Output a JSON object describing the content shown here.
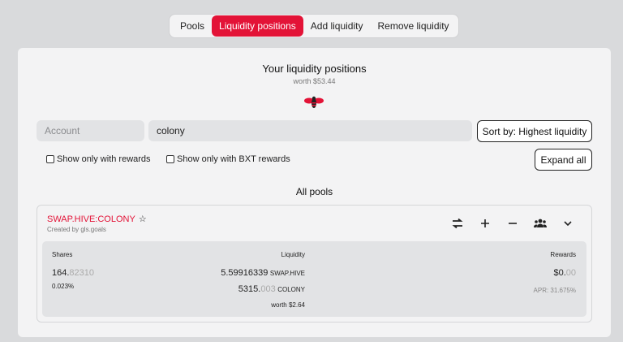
{
  "nav": {
    "tabs": [
      {
        "label": "Pools",
        "active": false
      },
      {
        "label": "Liquidity positions",
        "active": true
      },
      {
        "label": "Add liquidity",
        "active": false
      },
      {
        "label": "Remove liquidity",
        "active": false
      }
    ]
  },
  "header": {
    "title": "Your liquidity positions",
    "worth": "worth $53.44",
    "logo_icon": "hive-bee-icon"
  },
  "filters": {
    "account_placeholder": "Account",
    "search_value": "colony",
    "sort_label": "Sort by: Highest liquidity",
    "checkbox_rewards": "Show only with rewards",
    "checkbox_bxt": "Show only with BXT rewards",
    "expand_label": "Expand all"
  },
  "section_title": "All pools",
  "pool": {
    "name": "SWAP.HIVE:COLONY",
    "created_by": "Created by gls.goals",
    "shares_label": "Shares",
    "shares_main": "164.",
    "shares_dim": "82310",
    "shares_pct": "0.023%",
    "liquidity_label": "Liquidity",
    "liq1_amount": "5.59916339",
    "liq1_token": "SWAP.HIVE",
    "liq2_main": "5315.",
    "liq2_dim": "003",
    "liq2_token": "COLONY",
    "liq_worth": "worth $2.64",
    "rewards_label": "Rewards",
    "rewards_main": "$0.",
    "rewards_dim": "00",
    "apr": "APR: 31.675%"
  },
  "colors": {
    "accent": "#e31337",
    "background": "#d9dadc",
    "card": "#f3f3f4"
  }
}
